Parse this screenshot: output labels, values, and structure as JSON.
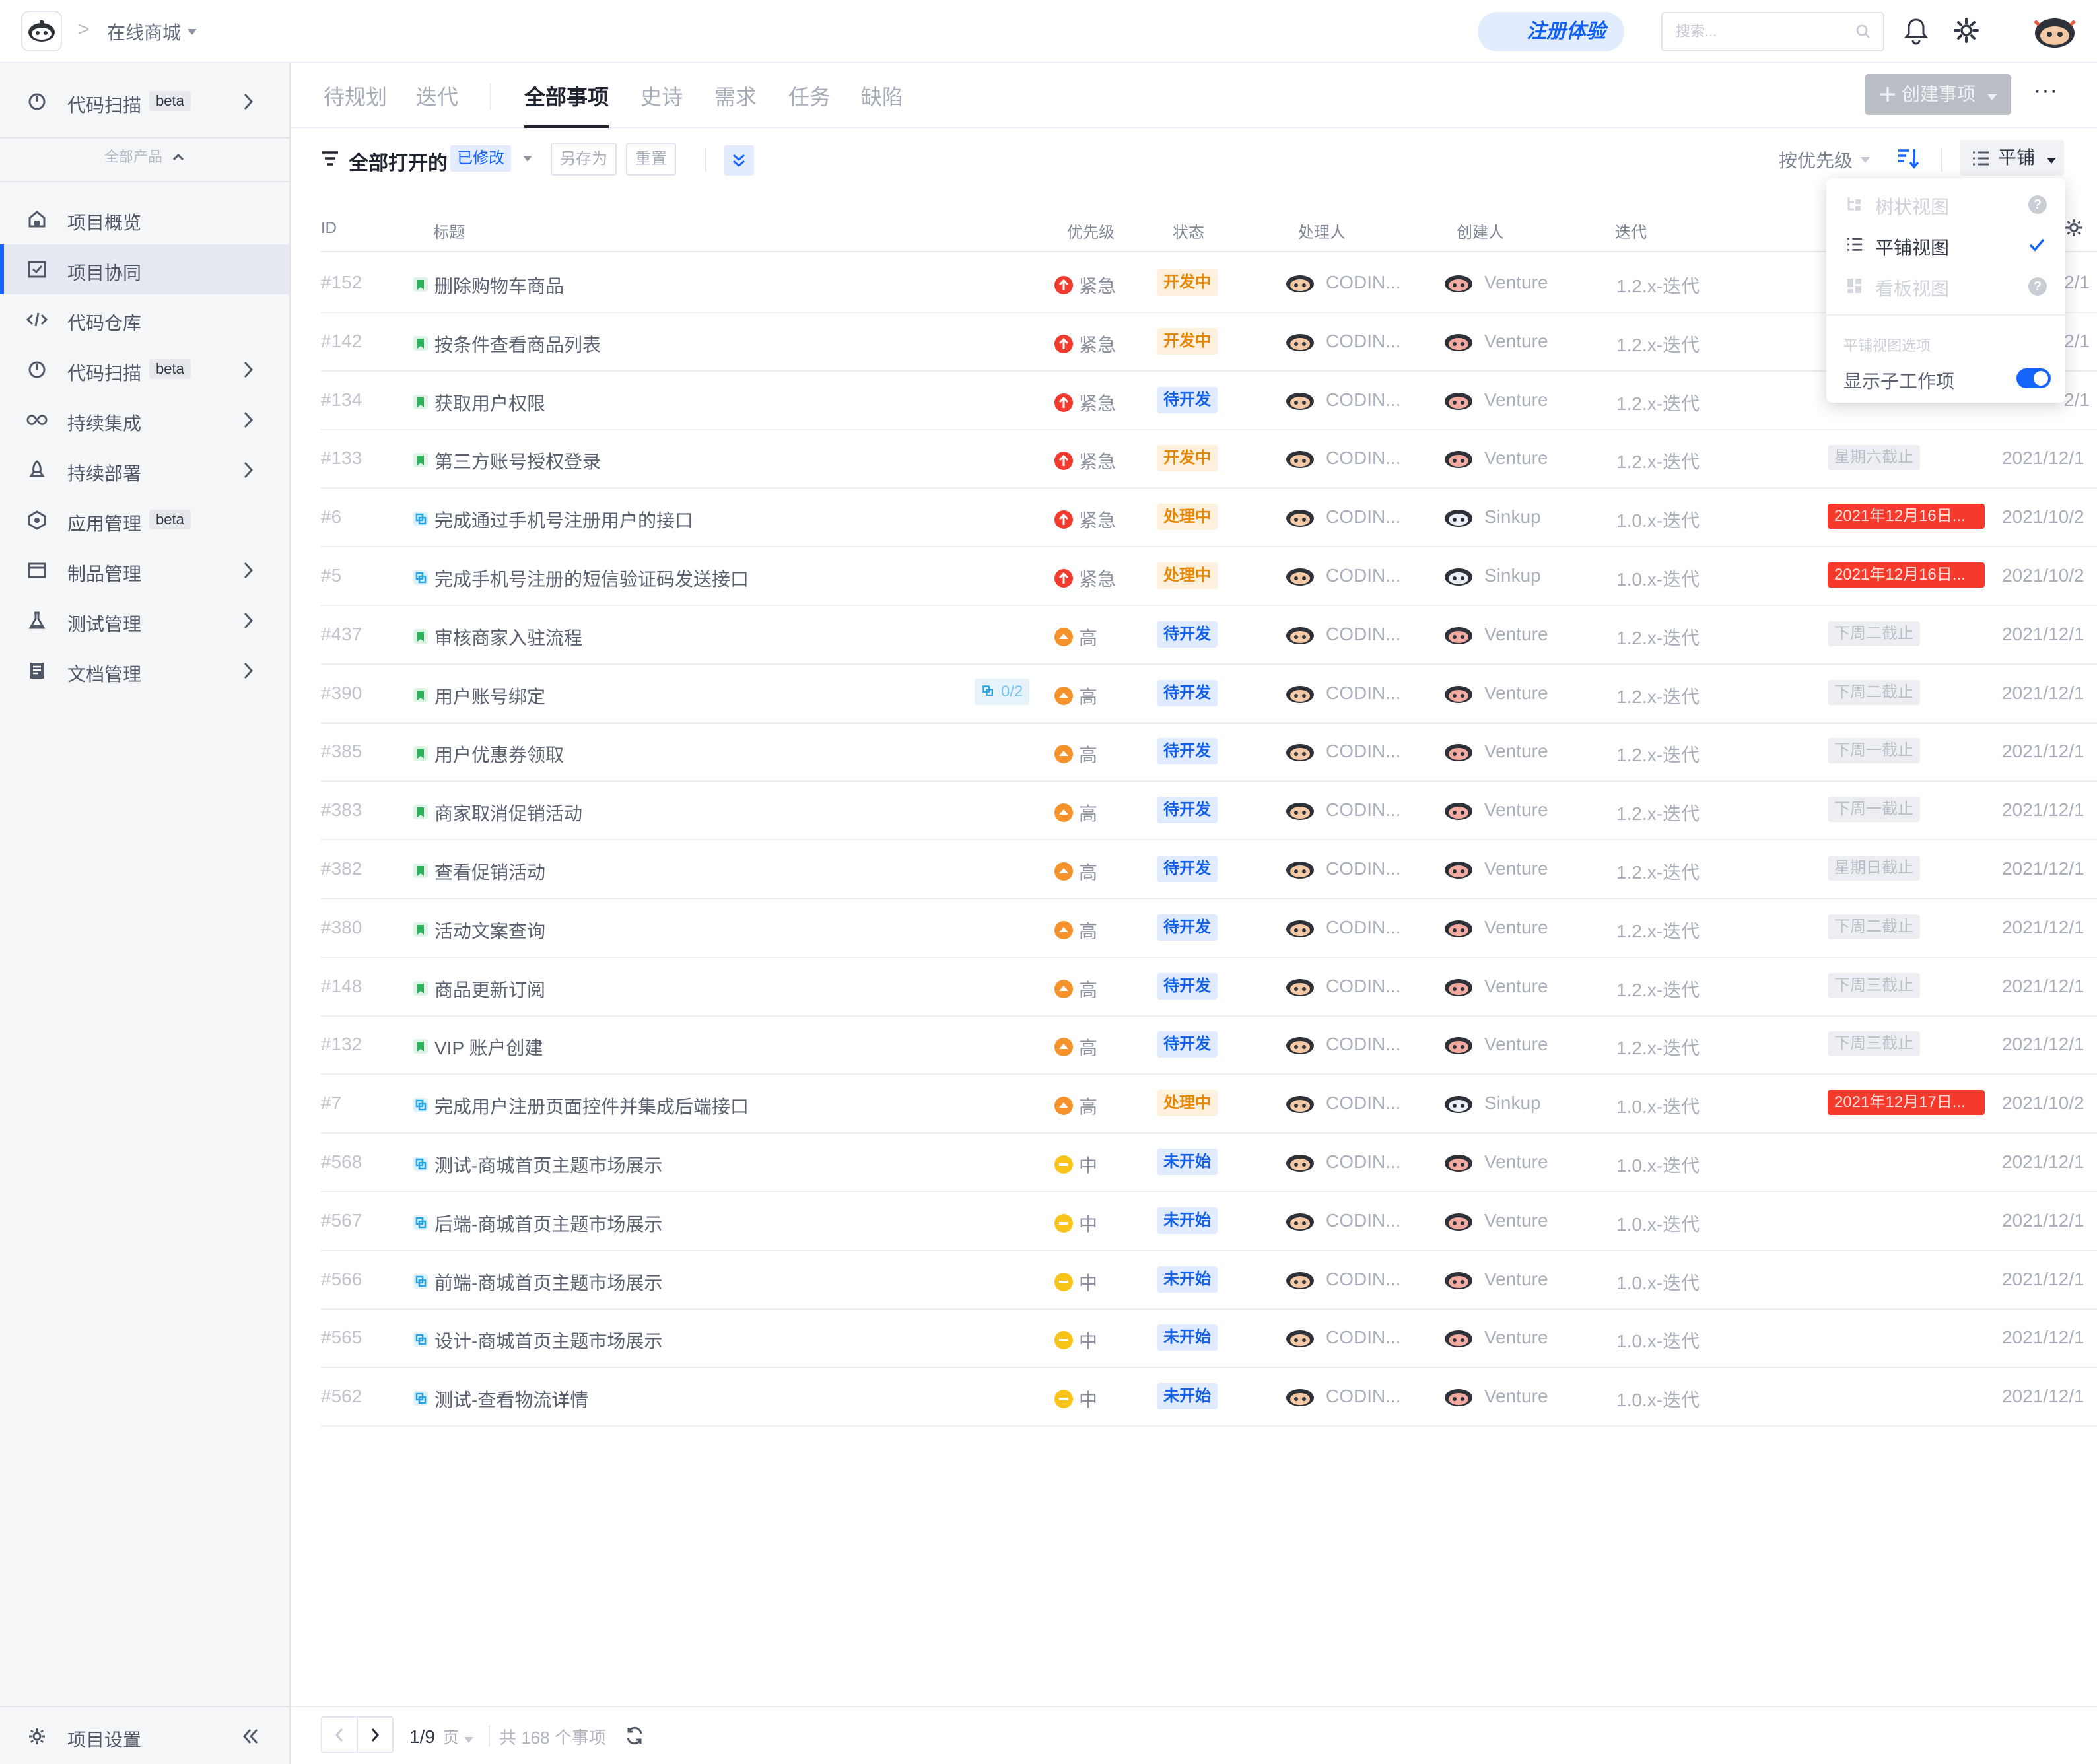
{
  "topbar": {
    "breadcrumb_sep": ">",
    "project": "在线商城",
    "trial_label": "注册体验",
    "search_placeholder": "搜索..."
  },
  "sidebar": {
    "top_item": {
      "label": "代码扫描",
      "badge": "beta"
    },
    "all_products": "全部产品",
    "items": [
      {
        "label": "项目概览"
      },
      {
        "label": "项目协同"
      },
      {
        "label": "代码仓库"
      },
      {
        "label": "代码扫描",
        "badge": "beta"
      },
      {
        "label": "持续集成"
      },
      {
        "label": "持续部署"
      },
      {
        "label": "应用管理",
        "badge": "beta"
      },
      {
        "label": "制品管理"
      },
      {
        "label": "测试管理"
      },
      {
        "label": "文档管理"
      }
    ],
    "settings_label": "项目设置"
  },
  "tabs": [
    "待规划",
    "迭代",
    "全部事项",
    "史诗",
    "需求",
    "任务",
    "缺陷"
  ],
  "create_button": "创建事项",
  "more_label": "···",
  "filter": {
    "title": "全部打开的",
    "modified": "已修改",
    "save_as": "另存为",
    "reset": "重置",
    "sort": "按优先级",
    "view": "平铺"
  },
  "table": {
    "headers": {
      "id": "ID",
      "title": "标题",
      "priority": "优先级",
      "status": "状态",
      "assignee": "处理人",
      "creator": "创建人",
      "iteration": "迭代"
    },
    "rows": [
      {
        "id": "#152",
        "title": "删除购物车商品",
        "ttype": "story",
        "priority": "紧急",
        "status": "开发中",
        "assignee": "CODIN...",
        "creator": "Venture",
        "iteration": "1.2.x-迭代",
        "due": "",
        "created": "2/1"
      },
      {
        "id": "#142",
        "title": "按条件查看商品列表",
        "ttype": "story",
        "priority": "紧急",
        "status": "开发中",
        "assignee": "CODIN...",
        "creator": "Venture",
        "iteration": "1.2.x-迭代",
        "due": "",
        "created": "2/1"
      },
      {
        "id": "#134",
        "title": "获取用户权限",
        "ttype": "story",
        "priority": "紧急",
        "status": "待开发",
        "assignee": "CODIN...",
        "creator": "Venture",
        "iteration": "1.2.x-迭代",
        "due": "",
        "created": "2/1"
      },
      {
        "id": "#133",
        "title": "第三方账号授权登录",
        "ttype": "story",
        "priority": "紧急",
        "status": "开发中",
        "assignee": "CODIN...",
        "creator": "Venture",
        "iteration": "1.2.x-迭代",
        "due": "星期六截止",
        "due_style": "soft",
        "created": "2021/12/1"
      },
      {
        "id": "#6",
        "title": "完成通过手机号注册用户的接口",
        "ttype": "task",
        "priority": "紧急",
        "status": "处理中",
        "assignee": "CODIN...",
        "creator": "Sinkup",
        "iteration": "1.0.x-迭代",
        "due": "2021年12月16日...",
        "due_style": "red",
        "created": "2021/10/2"
      },
      {
        "id": "#5",
        "title": "完成手机号注册的短信验证码发送接口",
        "ttype": "task",
        "priority": "紧急",
        "status": "处理中",
        "assignee": "CODIN...",
        "creator": "Sinkup",
        "iteration": "1.0.x-迭代",
        "due": "2021年12月16日...",
        "due_style": "red",
        "created": "2021/10/2"
      },
      {
        "id": "#437",
        "title": "审核商家入驻流程",
        "ttype": "story",
        "priority": "高",
        "status": "待开发",
        "assignee": "CODIN...",
        "creator": "Venture",
        "iteration": "1.2.x-迭代",
        "due": "下周二截止",
        "due_style": "soft",
        "created": "2021/12/1"
      },
      {
        "id": "#390",
        "title": "用户账号绑定",
        "ttype": "story",
        "sub": "0/2",
        "priority": "高",
        "status": "待开发",
        "assignee": "CODIN...",
        "creator": "Venture",
        "iteration": "1.2.x-迭代",
        "due": "下周二截止",
        "due_style": "soft",
        "created": "2021/12/1"
      },
      {
        "id": "#385",
        "title": "用户优惠券领取",
        "ttype": "story",
        "priority": "高",
        "status": "待开发",
        "assignee": "CODIN...",
        "creator": "Venture",
        "iteration": "1.2.x-迭代",
        "due": "下周一截止",
        "due_style": "soft",
        "created": "2021/12/1"
      },
      {
        "id": "#383",
        "title": "商家取消促销活动",
        "ttype": "story",
        "priority": "高",
        "status": "待开发",
        "assignee": "CODIN...",
        "creator": "Venture",
        "iteration": "1.2.x-迭代",
        "due": "下周一截止",
        "due_style": "soft",
        "created": "2021/12/1"
      },
      {
        "id": "#382",
        "title": "查看促销活动",
        "ttype": "story",
        "priority": "高",
        "status": "待开发",
        "assignee": "CODIN...",
        "creator": "Venture",
        "iteration": "1.2.x-迭代",
        "due": "星期日截止",
        "due_style": "soft",
        "created": "2021/12/1"
      },
      {
        "id": "#380",
        "title": "活动文案查询",
        "ttype": "story",
        "priority": "高",
        "status": "待开发",
        "assignee": "CODIN...",
        "creator": "Venture",
        "iteration": "1.2.x-迭代",
        "due": "下周二截止",
        "due_style": "soft",
        "created": "2021/12/1"
      },
      {
        "id": "#148",
        "title": "商品更新订阅",
        "ttype": "story",
        "priority": "高",
        "status": "待开发",
        "assignee": "CODIN...",
        "creator": "Venture",
        "iteration": "1.2.x-迭代",
        "due": "下周三截止",
        "due_style": "soft",
        "created": "2021/12/1"
      },
      {
        "id": "#132",
        "title": "VIP 账户创建",
        "ttype": "story",
        "priority": "高",
        "status": "待开发",
        "assignee": "CODIN...",
        "creator": "Venture",
        "iteration": "1.2.x-迭代",
        "due": "下周三截止",
        "due_style": "soft",
        "created": "2021/12/1"
      },
      {
        "id": "#7",
        "title": "完成用户注册页面控件并集成后端接口",
        "ttype": "task",
        "priority": "高",
        "status": "处理中",
        "assignee": "CODIN...",
        "creator": "Sinkup",
        "iteration": "1.0.x-迭代",
        "due": "2021年12月17日...",
        "due_style": "red",
        "created": "2021/10/2"
      },
      {
        "id": "#568",
        "title": "测试-商城首页主题市场展示",
        "ttype": "task",
        "priority": "中",
        "status": "未开始",
        "assignee": "CODIN...",
        "creator": "Venture",
        "iteration": "1.0.x-迭代",
        "due": "",
        "created": "2021/12/1"
      },
      {
        "id": "#567",
        "title": "后端-商城首页主题市场展示",
        "ttype": "task",
        "priority": "中",
        "status": "未开始",
        "assignee": "CODIN...",
        "creator": "Venture",
        "iteration": "1.0.x-迭代",
        "due": "",
        "created": "2021/12/1"
      },
      {
        "id": "#566",
        "title": "前端-商城首页主题市场展示",
        "ttype": "task",
        "priority": "中",
        "status": "未开始",
        "assignee": "CODIN...",
        "creator": "Venture",
        "iteration": "1.0.x-迭代",
        "due": "",
        "created": "2021/12/1"
      },
      {
        "id": "#565",
        "title": "设计-商城首页主题市场展示",
        "ttype": "task",
        "priority": "中",
        "status": "未开始",
        "assignee": "CODIN...",
        "creator": "Venture",
        "iteration": "1.0.x-迭代",
        "due": "",
        "created": "2021/12/1"
      },
      {
        "id": "#562",
        "title": "测试-查看物流详情",
        "ttype": "task",
        "priority": "中",
        "status": "未开始",
        "assignee": "CODIN...",
        "creator": "Venture",
        "iteration": "1.0.x-迭代",
        "due": "",
        "created": "2021/12/1"
      }
    ]
  },
  "view_menu": {
    "items": [
      {
        "label": "树状视图",
        "disabled": true,
        "help": "?"
      },
      {
        "label": "平铺视图",
        "selected": true
      },
      {
        "label": "看板视图",
        "disabled": true,
        "help": "?"
      }
    ],
    "section": "平铺视图选项",
    "toggle_label": "显示子工作项",
    "toggle_on": true
  },
  "pagination": {
    "page": "1/9",
    "page_unit": "页",
    "total": "共 168 个事项"
  },
  "colors": {
    "primary": "#1664ff",
    "urgent": "#f03a2e",
    "high": "#f5922c",
    "medium": "#f9c41a"
  }
}
